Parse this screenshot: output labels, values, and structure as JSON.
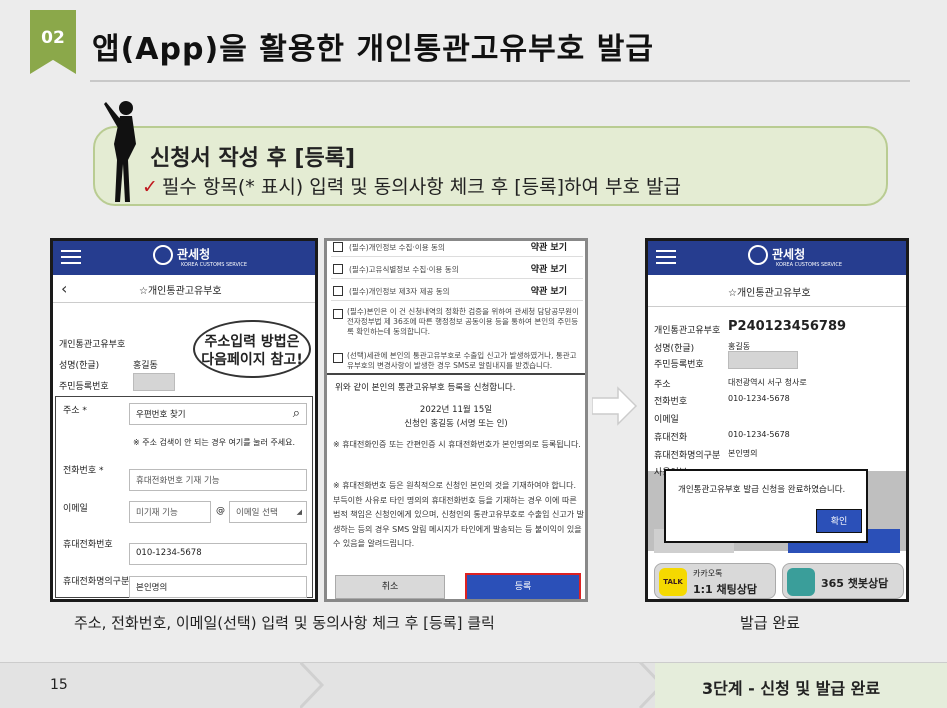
{
  "header": {
    "badge": "02",
    "title": "앱(App)을 활용한 개인통관고유부호 발급"
  },
  "banner": {
    "heading": "신청서 작성 후 [등록]",
    "check": "✓",
    "sub": "필수 항목(* 표시) 입력 및 동의사항 체크 후 [등록]하여 부호 발급"
  },
  "phone1": {
    "logo": "관세청",
    "logo_sub": "KOREA CUSTOMS SERVICE",
    "nav_title": "☆개인통관고유부호",
    "rows": {
      "code": "개인통관고유부호",
      "name_label": "성명(한글)",
      "name": "홍길동",
      "rrn": "주민등록번호"
    },
    "addr_label": "주소 *",
    "addr_btn": "우편번호 찾기",
    "addr_note": "※ 주소 검색이 안 되는 경우 여기를 눌러 주세요.",
    "phone_label": "전화번호 *",
    "phone_ph": "휴대전화번호 기재 기능",
    "email_label": "이메일",
    "email_ph": "미기재 기능",
    "at": "@",
    "email_sel": "이메일 선택",
    "mobile_label": "휴대전화번호",
    "mobile": "010-1234-5678",
    "type_label": "휴대전화명의구분",
    "type": "본인명의"
  },
  "callout": "주소입력 방법은\n다음페이지 참고!",
  "phone2": {
    "agreements": [
      {
        "t": "(필수)개인정보 수집·이용 동의",
        "b": "약관 보기"
      },
      {
        "t": "(필수)고유식별정보 수집·이용 동의",
        "b": "약관 보기"
      },
      {
        "t": "(필수)개인정보 제3자 제공 동의",
        "b": "약관 보기"
      }
    ],
    "p1": "(필수)본인은 이 건 신청내역의 정확한 검증을 위하여 관세청 담당공무원이 전자정부법 제 36조에 따른 행정정보 공동이용 등을 통하여 본인의 주민등록 확인하는데 동의합니다.",
    "p2": "(선택)세관에 본인의 통관고유부호로 수출입 신고가 발생하였거나, 통관고유부호의 변경사항이 발생한 경우 SMS로 알림내지를 받겠습니다.",
    "confirm": "위와 같이 본인의 통관고유부호 등록을 신청합니다.",
    "date": "2022년 11월 15일",
    "signer": "신청인 홍길동 (서명 또는 인)",
    "note1": "※ 휴대전화인증 또는 간편인증 시 휴대전화번호가 본인명의로 등록됩니다.",
    "note2": "※ 휴대전화번호 등은 원칙적으로 신청인 본인의 것을 기재하여야 합니다. 부득이한 사유로 타인 명의의 휴대전화번호 등을 기재하는 경우 이에 따른 법적 책임은 신청인에게 있으며, 신청인의 통관고유부호로 수출입 신고가 발생하는 등의 경우 SMS 알림 메시지가 타인에게 발송되는 등 불이익이 있을 수 있음을 알려드립니다.",
    "cancel": "취소",
    "submit": "등록"
  },
  "phone3": {
    "logo": "관세청",
    "logo_sub": "KOREA CUSTOMS SERVICE",
    "nav_title": "☆개인통관고유부호",
    "code_label": "개인통관고유부호",
    "code": "P240123456789",
    "name_label": "성명(한글)",
    "name": "홍길동",
    "rrn_label": "주민등록번호",
    "addr_label": "주소",
    "addr": "대전광역시 서구 청사로",
    "tel_label": "전화번호",
    "tel": "010-1234-5678",
    "email_label": "이메일",
    "mobile_label": "휴대전화",
    "mobile": "010-1234-5678",
    "type_label": "휴대전화명의구분",
    "type": "본인명의",
    "use_label": "사용여부",
    "dialog": "개인통관고유부호 발급 신청을 완료하였습니다.",
    "ok": "확인",
    "kakao_top": "카카오톡",
    "kakao": "1:1 채팅상담",
    "talk": "TALK",
    "chatbot": "365 챗봇상담"
  },
  "captions": {
    "left": "주소, 전화번호, 이메일(선택) 입력 및 동의사항 체크 후 [등록] 클릭",
    "right": "발급 완료"
  },
  "footer": {
    "page": "15",
    "step": "3단계 - 신청 및 발급 완료"
  }
}
